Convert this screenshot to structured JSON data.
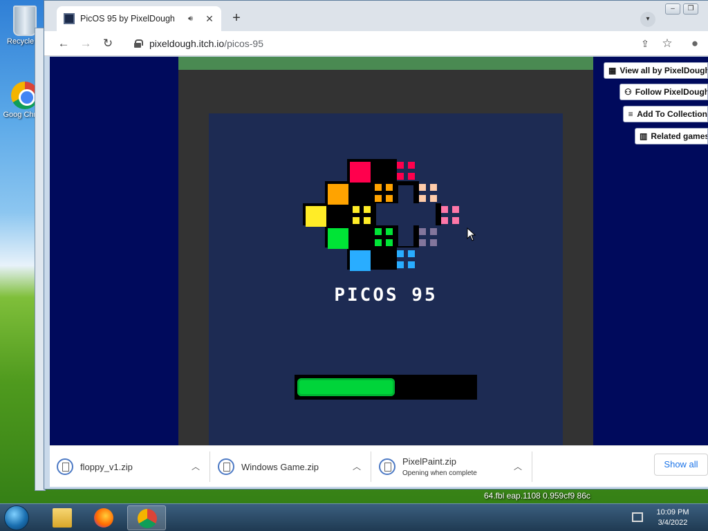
{
  "desktop": {
    "icons": [
      {
        "label": "Recycle Bi"
      },
      {
        "label": "Goog Chrom"
      }
    ],
    "wallpaper_text": "64.fbl  eap.1108  0.959cf9  86c"
  },
  "browser": {
    "tab": {
      "title": "PicOS 95 by PixelDough",
      "audio_icon": "speaker-icon",
      "close_label": "✕"
    },
    "new_tab_label": "+",
    "tab_search_icon": "chevron-down-icon",
    "window_controls": [
      "‒",
      "❐"
    ],
    "nav": {
      "back": "←",
      "forward": "→",
      "reload": "↻"
    },
    "address": {
      "host": "pixeldough.itch.io",
      "path": "/picos-95"
    },
    "toolbar_right": {
      "share": "⇪",
      "star": "☆",
      "profile": "●"
    }
  },
  "page": {
    "game": {
      "title": "PICOS 95",
      "progress": 0.55,
      "colors": {
        "bg": "#1d2b53",
        "panel": "#333333",
        "topbar": "#4a8a52",
        "progress": "#00d43a"
      }
    },
    "side_buttons": [
      {
        "label": "View all by PixelDough",
        "icon": "itchio-icon",
        "glyph": "▦"
      },
      {
        "label": "Follow PixelDough",
        "icon": "add-user-icon",
        "glyph": "⚇"
      },
      {
        "label": "Add To Collection",
        "icon": "playlist-add-icon",
        "glyph": "≡"
      },
      {
        "label": "Related games",
        "icon": "map-icon",
        "glyph": "▥"
      }
    ]
  },
  "downloads": {
    "items": [
      {
        "name": "floppy_v1.zip",
        "status": ""
      },
      {
        "name": "Windows Game.zip",
        "status": ""
      },
      {
        "name": "PixelPaint.zip",
        "status": "Opening when complete"
      }
    ],
    "show_all": "Show all"
  },
  "taskbar": {
    "time": "10:09 PM",
    "date": "3/4/2022"
  }
}
